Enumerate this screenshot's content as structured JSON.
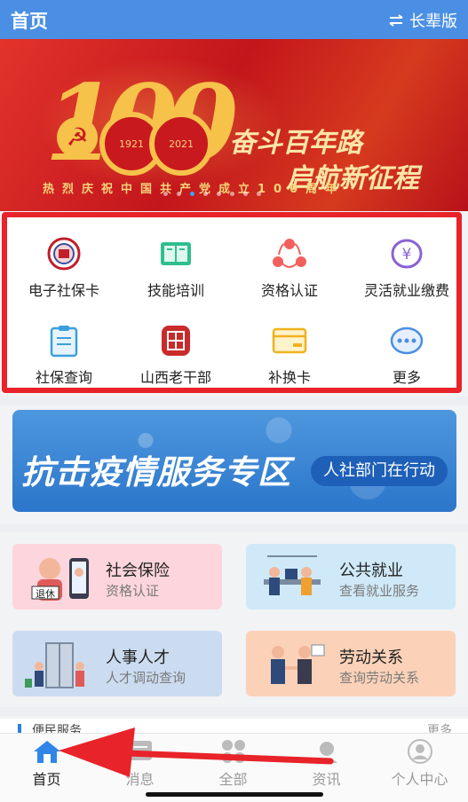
{
  "header": {
    "title": "首页",
    "elder_label": "长辈版",
    "elder_icon": "swap-arrows-icon"
  },
  "banner": {
    "number": "100",
    "year_left": "1921",
    "year_right": "2021",
    "slogan_line1": "奋斗百年路",
    "slogan_line2": "启航新征程",
    "subtitle": "热烈庆祝中国共产党成立100周年",
    "slide_count": 8,
    "active_slide": 2
  },
  "services": [
    {
      "label": "电子社保卡",
      "icon": "social-security-card-icon"
    },
    {
      "label": "技能培训",
      "icon": "book-icon"
    },
    {
      "label": "资格认证",
      "icon": "users-network-icon"
    },
    {
      "label": "灵活就业缴费",
      "icon": "yuan-coin-icon"
    },
    {
      "label": "社保查询",
      "icon": "clipboard-icon"
    },
    {
      "label": "山西老干部",
      "icon": "seal-icon"
    },
    {
      "label": "补换卡",
      "icon": "card-icon"
    },
    {
      "label": "更多",
      "icon": "more-icon"
    }
  ],
  "epidemic": {
    "title": "抗击疫情服务专区",
    "tag": "人社部门在行动"
  },
  "cards": [
    {
      "title": "社会保险",
      "subtitle": "资格认证",
      "badge": "退休",
      "color": "#fcd6dc"
    },
    {
      "title": "公共就业",
      "subtitle": "查看就业服务",
      "color": "#cfe9f8"
    },
    {
      "title": "人事人才",
      "subtitle": "人才调动查询",
      "color": "#cbdcf0"
    },
    {
      "title": "劳动关系",
      "subtitle": "查询劳动关系",
      "color": "#fbd2b8"
    }
  ],
  "section_peek": {
    "title": "便民服务",
    "more": "更多"
  },
  "tabs": [
    {
      "label": "首页",
      "icon": "home-icon",
      "active": true
    },
    {
      "label": "消息",
      "icon": "message-icon",
      "active": false
    },
    {
      "label": "全部",
      "icon": "grid-icon",
      "active": false
    },
    {
      "label": "资讯",
      "icon": "news-icon",
      "active": false
    },
    {
      "label": "个人中心",
      "icon": "person-icon",
      "active": false
    }
  ],
  "colors": {
    "brand_blue": "#4a8fe3",
    "annotation_red": "#e8232a"
  }
}
